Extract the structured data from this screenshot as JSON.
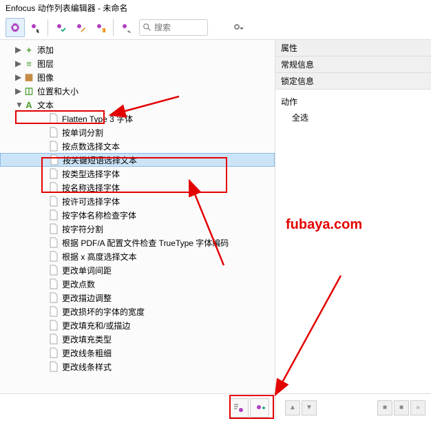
{
  "window": {
    "title": "Enfocus 动作列表编辑器 - 未命名"
  },
  "search": {
    "placeholder": "搜索"
  },
  "categories": [
    {
      "expanded": false,
      "arrow": "▶",
      "label": "添加",
      "color": "#4b9b2f",
      "symbol": "+"
    },
    {
      "expanded": false,
      "arrow": "▶",
      "label": "图层",
      "color": "#4b9b2f",
      "symbol": "≡"
    },
    {
      "expanded": false,
      "arrow": "▶",
      "label": "图像",
      "color": "#c08030",
      "symbol": "▦"
    },
    {
      "expanded": false,
      "arrow": "▶",
      "label": "位置和大小",
      "color": "#4b9b2f",
      "symbol": "◫"
    },
    {
      "expanded": true,
      "arrow": "▼",
      "label": "文本",
      "color": "#4b9b2f",
      "symbol": "A"
    }
  ],
  "textChildren": [
    "Flatten Type 3 字体",
    "按单词分割",
    "按点数选择文本",
    "按关键短语选择文本",
    "按类型选择字体",
    "按名称选择字体",
    "按许可选择字体",
    "按字体名称检查字体",
    "按字符分割",
    "根据 PDF/A 配置文件检查 TrueType 字体编码",
    "根据 x 高度选择文本",
    "更改单词间距",
    "更改点数",
    "更改描边调整",
    "更改损坏的字体的宽度",
    "更改填充和/或描边",
    "更改填充类型",
    "更改线条粗细",
    "更改线条样式"
  ],
  "selectedIndex": 3,
  "rightPanel": {
    "properties": "属性",
    "general": "常规信息",
    "lock": "锁定信息",
    "action": "动作",
    "selectAll": "全选"
  },
  "watermark": "fubaya.com"
}
